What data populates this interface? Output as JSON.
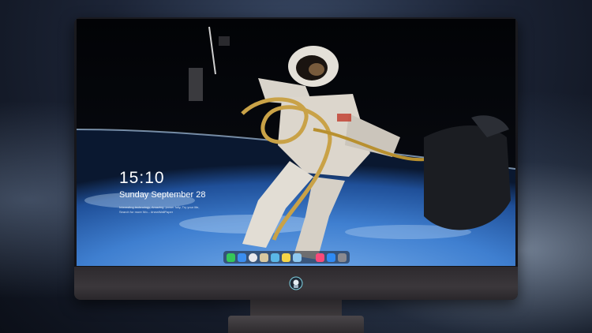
{
  "lock_screen": {
    "time": "15:10",
    "date": "Sunday September 28",
    "note": "Interesting technology, Amazing, power fully, Try your life, Search for more Wo... #newWallPaper"
  },
  "dock": {
    "apps": [
      {
        "icon": "messages-icon",
        "color": "#35c759"
      },
      {
        "icon": "finder-icon",
        "color": "#3b8ef0"
      },
      {
        "icon": "safari-icon",
        "color": "#e8e8ec"
      },
      {
        "icon": "preview-icon",
        "color": "#d8c8a0"
      },
      {
        "icon": "claquette-icon",
        "color": "#5ab7e6"
      },
      {
        "icon": "notes-icon",
        "color": "#f5d547"
      },
      {
        "icon": "photos-icon",
        "color": "#8ec8f0"
      },
      {
        "icon": "music-icon",
        "color": "#fa4a7a"
      },
      {
        "icon": "app-store-icon",
        "color": "#2f8bf5"
      },
      {
        "icon": "camera-icon",
        "color": "#8a8a90"
      }
    ]
  },
  "colors": {
    "bezel": "#141418",
    "chin": "#3a363a",
    "earth_blue": "#3f7fd0"
  }
}
